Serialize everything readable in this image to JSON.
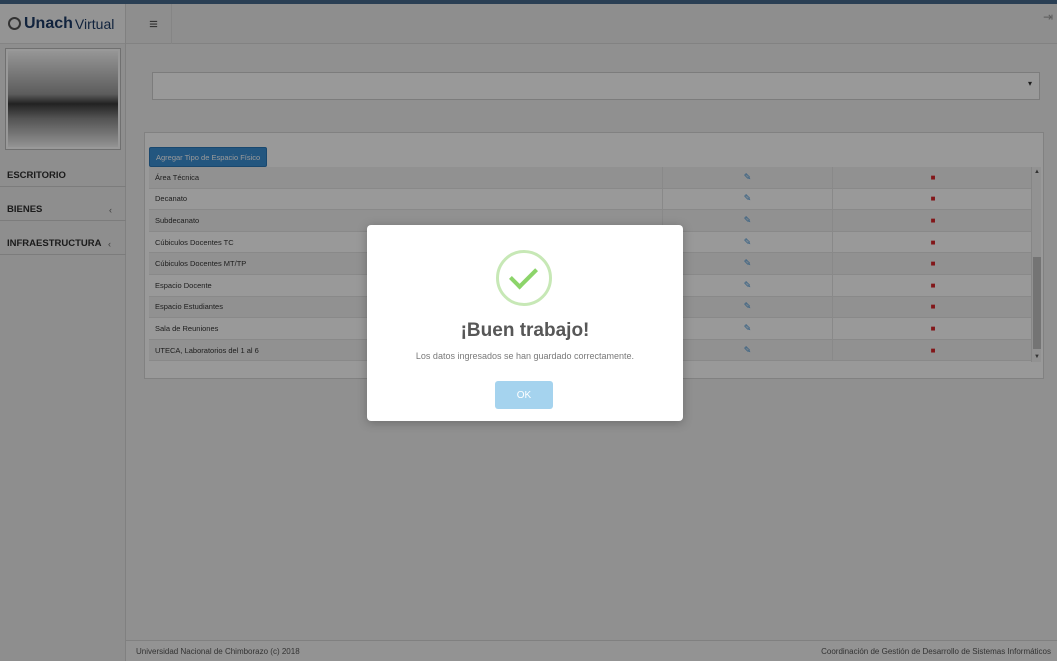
{
  "brand": {
    "name_bold": "Unach",
    "name_light": "Virtual"
  },
  "sidebar": {
    "items": [
      {
        "label": "ESCRITORIO",
        "chevron": ""
      },
      {
        "label": "BIENES",
        "chevron": "‹"
      },
      {
        "label": "INFRAESTRUCTURA",
        "chevron": "‹"
      }
    ]
  },
  "topnav": {
    "menu_icon": "≡",
    "logout_icon": "⇥"
  },
  "main": {
    "select_arrow": "▾",
    "add_button": "Agregar Tipo de Espacio Físico",
    "rows": [
      {
        "name": "Área Técnica"
      },
      {
        "name": "Decanato"
      },
      {
        "name": "Subdecanato"
      },
      {
        "name": "Cúbiculos Docentes TC"
      },
      {
        "name": "Cúbiculos Docentes MT/TP"
      },
      {
        "name": "Espacio Docente"
      },
      {
        "name": "Espacio Estudiantes"
      },
      {
        "name": "Sala de Reuniones"
      },
      {
        "name": "UTECA, Laboratorios del 1 al 6"
      }
    ],
    "edit_icon": "✎",
    "delete_icon": "■"
  },
  "footer": {
    "left": "Universidad Nacional de Chimborazo (c) 2018",
    "right": "Coordinación de Gestión de Desarrollo de Sistemas Informáticos"
  },
  "modal": {
    "title": "¡Buen trabajo!",
    "text": "Los datos ingresados se han guardado correctamente.",
    "ok_label": "OK"
  },
  "colors": {
    "primary": "#3b8fd4",
    "danger": "#d9262b",
    "success": "#8cd46a",
    "ok_button": "#a5d3ee"
  }
}
